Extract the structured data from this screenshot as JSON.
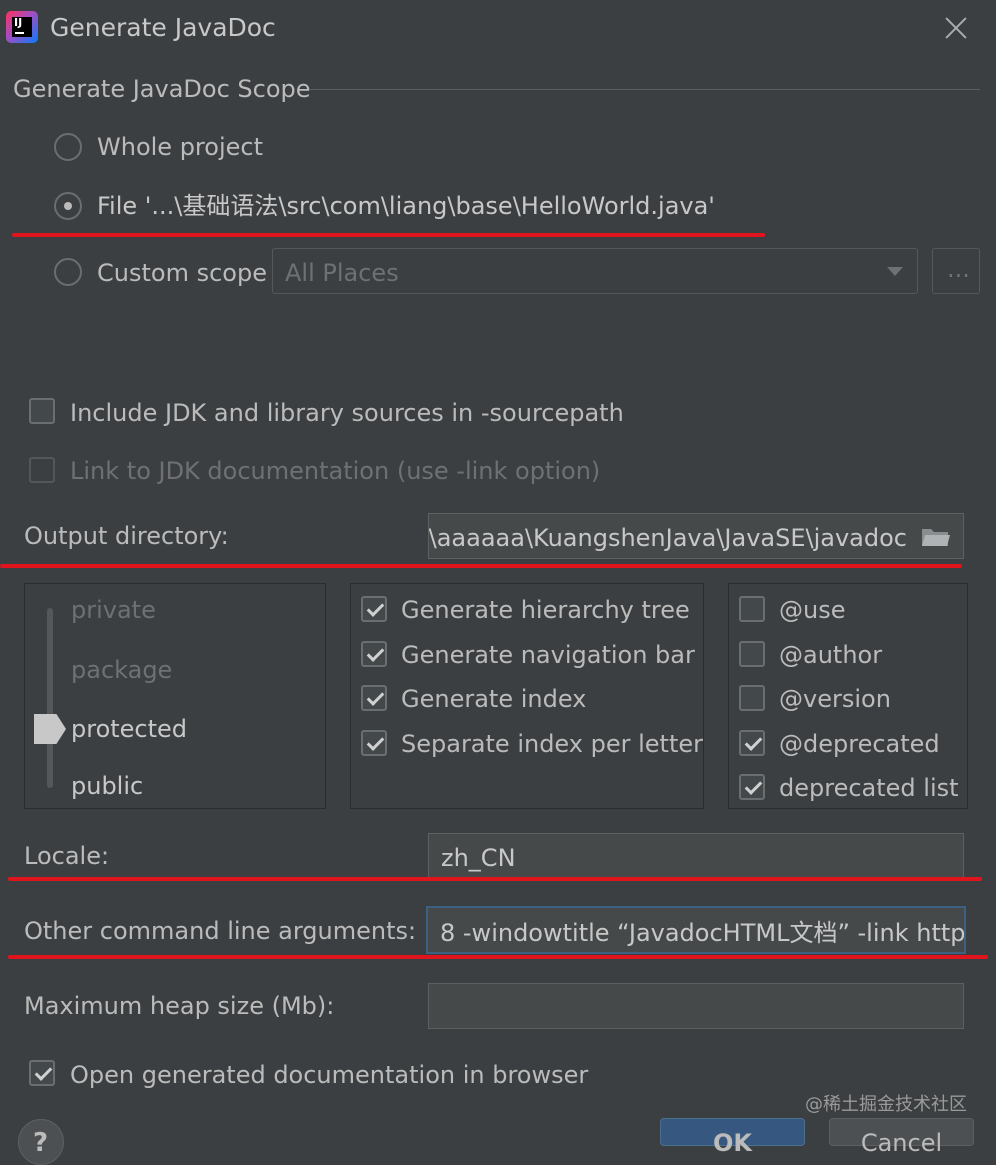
{
  "window": {
    "title": "Generate JavaDoc",
    "app_icon_text": "IJ"
  },
  "scope": {
    "heading": "Generate JavaDoc Scope",
    "whole_project": "Whole project",
    "file": "File '...\\基础语法\\src\\com\\liang\\base\\HelloWorld.java'",
    "custom_scope": "Custom scope",
    "custom_scope_value": "All Places",
    "browse_button": "...",
    "selected": "file"
  },
  "options": {
    "include_jdk": "Include JDK and library sources in -sourcepath",
    "link_jdk": "Link to JDK documentation (use -link option)"
  },
  "output": {
    "label": "Output directory:",
    "value": "D:\\aaaaaa\\KuangshenJava\\JavaSE\\javadoc"
  },
  "visibility": {
    "levels": [
      "private",
      "package",
      "protected",
      "public"
    ],
    "selected": "protected"
  },
  "generate_checks": [
    {
      "label": "Generate hierarchy tree",
      "checked": true
    },
    {
      "label": "Generate navigation bar",
      "checked": true
    },
    {
      "label": "Generate index",
      "checked": true
    },
    {
      "label": "Separate index per letter",
      "checked": true
    }
  ],
  "tag_checks": [
    {
      "label": "@use",
      "checked": false
    },
    {
      "label": "@author",
      "checked": false
    },
    {
      "label": "@version",
      "checked": false
    },
    {
      "label": "@deprecated",
      "checked": true
    },
    {
      "label": "deprecated list",
      "checked": true
    }
  ],
  "locale": {
    "label": "Locale:",
    "value": "zh_CN"
  },
  "args": {
    "label": "Other command line arguments:",
    "value": "8 -windowtitle “JavadocHTML文档” -link http"
  },
  "heap": {
    "label": "Maximum heap size (Mb):",
    "value": ""
  },
  "open_browser": {
    "label": "Open generated documentation in browser",
    "checked": true
  },
  "buttons": {
    "help": "?",
    "ok": "OK",
    "cancel": "Cancel"
  },
  "watermark": "@稀土掘金技术社区",
  "colors": {
    "background": "#3c3f41",
    "text": "#bbbbbb",
    "annotation": "#e0141c",
    "primary": "#365880"
  }
}
